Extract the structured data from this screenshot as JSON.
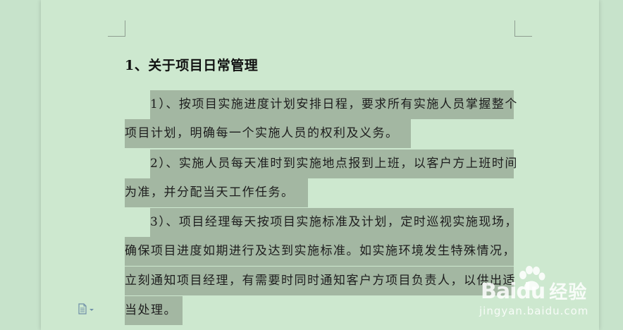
{
  "document": {
    "heading": "1、关于项目日常管理",
    "lines": [
      "1）、按项目实施进度计划安排日程，要求所有实施人员掌握整个",
      "项目计划，明确每一个实施人员的权利及义务。",
      "2）、实施人员每天准时到实施地点报到上班，以客户方上班时间",
      "为准，并分配当天工作任务。",
      "3）、项目经理每天按项目实施标准及计划，定时巡视实施现场，",
      "确保项目进度如期进行及达到实施标准。如实施环境发生特殊情况，",
      "立刻通知项目经理，有需要时同时通知客户方项目负责人，以供出适",
      "当处理。"
    ]
  },
  "watermark": {
    "brand_latin": "Bai",
    "brand_du": "du",
    "brand_cn": "经验",
    "url": "jingyan.baidu.com"
  },
  "colors": {
    "page_background": "#cde8cf",
    "outer_background": "#c7e3cb",
    "selection_highlight": "#a3b7a2",
    "text": "#1d1d1d"
  },
  "icons": {
    "doc_options": "document-options-icon",
    "watermark_logo": "baidu-paw-icon"
  }
}
